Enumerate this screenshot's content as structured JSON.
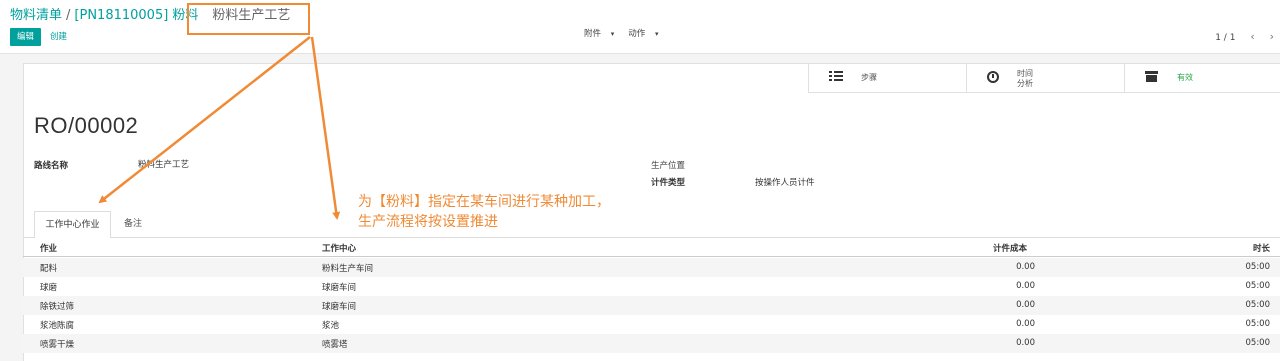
{
  "breadcrumb": {
    "root": "物料清单",
    "parent": "[PN18110005] 粉料",
    "current": "粉料生产工艺"
  },
  "toolbar": {
    "edit_label": "编辑",
    "create_label": "创建",
    "attachments_label": "附件",
    "action_label": "动作"
  },
  "pager": {
    "value": "1 / 1",
    "prev_glyph": "‹",
    "next_glyph": "›"
  },
  "button_box": {
    "steps_label": "步骤",
    "time_label_1": "时间",
    "time_label_2": "分析",
    "active_label": "有效"
  },
  "record": {
    "title": "RO/00002",
    "route_name_label": "路线名称",
    "route_name_value": "粉料生产工艺",
    "location_label": "生产位置",
    "count_type_label": "计件类型",
    "count_type_value": "按操作人员计件"
  },
  "tabs": {
    "workcenter_ops": "工作中心作业",
    "notes": "备注"
  },
  "table": {
    "headers": {
      "operation": "作业",
      "workcenter": "工作中心",
      "piece_cost": "计件成本",
      "duration": "时长"
    },
    "rows": [
      {
        "operation": "配料",
        "workcenter": "粉料生产车间",
        "piece_cost": "0.00",
        "duration": "05:00"
      },
      {
        "operation": "球磨",
        "workcenter": "球磨车间",
        "piece_cost": "0.00",
        "duration": "05:00"
      },
      {
        "operation": "除铁过筛",
        "workcenter": "球磨车间",
        "piece_cost": "0.00",
        "duration": "05:00"
      },
      {
        "operation": "浆池陈腐",
        "workcenter": "浆池",
        "piece_cost": "0.00",
        "duration": "05:00"
      },
      {
        "operation": "喷雾干燥",
        "workcenter": "喷雾塔",
        "piece_cost": "0.00",
        "duration": "05:00"
      }
    ]
  },
  "annotation": {
    "line1": "为【粉料】指定在某车间进行某种加工，",
    "line2": "生产流程将按设置推进",
    "color": "#F08A35"
  },
  "colors": {
    "accent": "#00A09D",
    "active_status": "#28a745"
  }
}
